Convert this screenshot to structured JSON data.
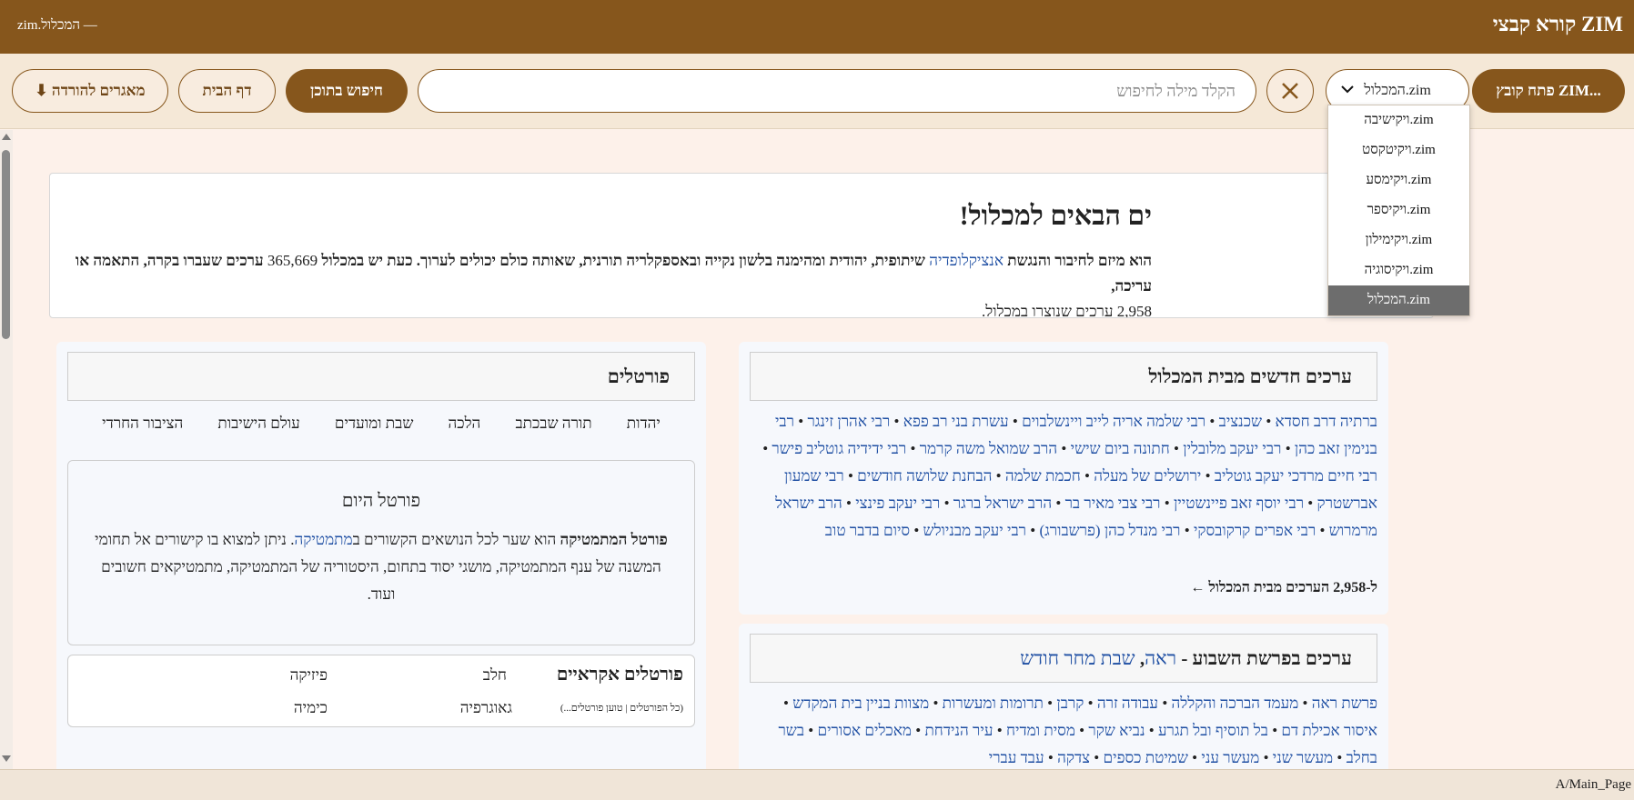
{
  "app": {
    "title": "קורא קבצי ZIM",
    "subtitle": "zim.המכלול —"
  },
  "toolbar": {
    "open_file": "פתח קובץ ZIM...",
    "file_select": "המכלול.zim",
    "search_placeholder": "הקלד מילה לחיפוש",
    "search_value": "",
    "search_button": "חיפוש בתוכן",
    "home_button": "דף הבית",
    "downloads_button": "⬇ מאגרים להורדה"
  },
  "dropdown": {
    "options": [
      "ויקישיבה.zim",
      "ויקיטקסט.zim",
      "ויקימסע.zim",
      "ויקיספר.zim",
      "ויקימילון.zim",
      "ויקיסוגיה.zim",
      "המכלול.zim"
    ],
    "selected": "המכלול.zim"
  },
  "welcome": {
    "title": "ים הבאים למכלול!",
    "body_1": "הוא מיזם לחיבור והנגשת",
    "body_link": "אנציקלופדיה",
    "body_2": "שיתופית, יהודית ומהימנה בלשון נקייה ובאספקלריה תורנית, שאותה כולם יכולים לערוך. כעת יש במכלול",
    "article_count": "365,669",
    "body_3": "ערכים שעברו בקרה, התאמה או עריכה,",
    "body_line2": "2,958 ערכים שנוצרו במכלול."
  },
  "new_articles": {
    "title": "ערכים חדשים מבית המכלול",
    "items": [
      "ברתיה דרב חסדא",
      "שכנציב",
      "רבי שלמה אריה לייב ויינשלבוים",
      "עשרת בני רב פפא",
      "רבי אהרן זינגר",
      "רבי בנימין זאב כהן",
      "רבי יעקב מלובלין",
      "חתונה ביום שישי",
      "הרב שמואל משה קרמר",
      "רבי ידידיה גוטליב פישר",
      "רבי חיים מרדכי יעקב גוטליב",
      "ירושלים של מעלה",
      "חכמת שלמה",
      "הבחנת שלושה חודשים",
      "רבי שמעון אברשטרק",
      "רבי יוסף זאב פיינשטיין",
      "רבי צבי מאיר בר",
      "הרב ישראל ברגר",
      "רבי יעקב פינצי",
      "הרב ישראל מרמרוש",
      "רבי אפרים קרקובסקי",
      "רבי מנדל כהן (פרשבורג)",
      "רבי יעקב מבניולש",
      "סיום בדבר טוב"
    ],
    "more_prefix": "ל-",
    "more_count": "2,958",
    "more_suffix": "הערכים מבית המכלול",
    "more_arrow": "←"
  },
  "parasha": {
    "title_prefix": "ערכים בפרשת השבוע -",
    "title_link_1": "ראה",
    "title_sep": ",",
    "title_link_2": "שבת מחר חודש",
    "items": [
      "פרשת ראה",
      "מעמד הברכה והקללה",
      "עבודה זרה",
      "קרבן",
      "תרומות ומעשרות",
      "מצוות בניין בית המקדש",
      "איסור אכילת דם",
      "בל תוסיף ובל תגרע",
      "נביא שקר",
      "מסית ומדיח",
      "עיר הנידחת",
      "מאכלים אסורים",
      "בשר בחלב",
      "מעשר שני",
      "מעשר עני",
      "שמיטת כספים",
      "צדקה",
      "עבד עברי"
    ]
  },
  "portals": {
    "title": "פורטלים",
    "links": [
      "יהדות",
      "תורה שבכתב",
      "הלכה",
      "שבת ומועדים",
      "עולם הישיבות",
      "הציבור החרדי"
    ],
    "today_title": "פורטל היום",
    "today_bold": "פורטל המתמטיקה",
    "today_text_1": "הוא שער לכל הנושאים הקשורים ב",
    "today_link": "מתמטיקה",
    "today_text_2": ". ניתן למצוא בו קישורים אל תחומי המשנה של ענף המתמטיקה, מושגי יסוד בתחום, היסטוריה של המתמטיקה, מתמטיקאים חשובים ועוד.",
    "random_title": "פורטלים אקראיים",
    "random_sub": "(כל הפורטלים | טוען פורטלים...)",
    "random_items": [
      "חלב",
      "פיזיקה",
      "גאוגרפיה",
      "כימיה"
    ]
  },
  "status": {
    "path": "A/Main_Page"
  },
  "colors": {
    "accent": "#86561c",
    "link": "#1f4fa3",
    "background": "#fdf1ea"
  }
}
